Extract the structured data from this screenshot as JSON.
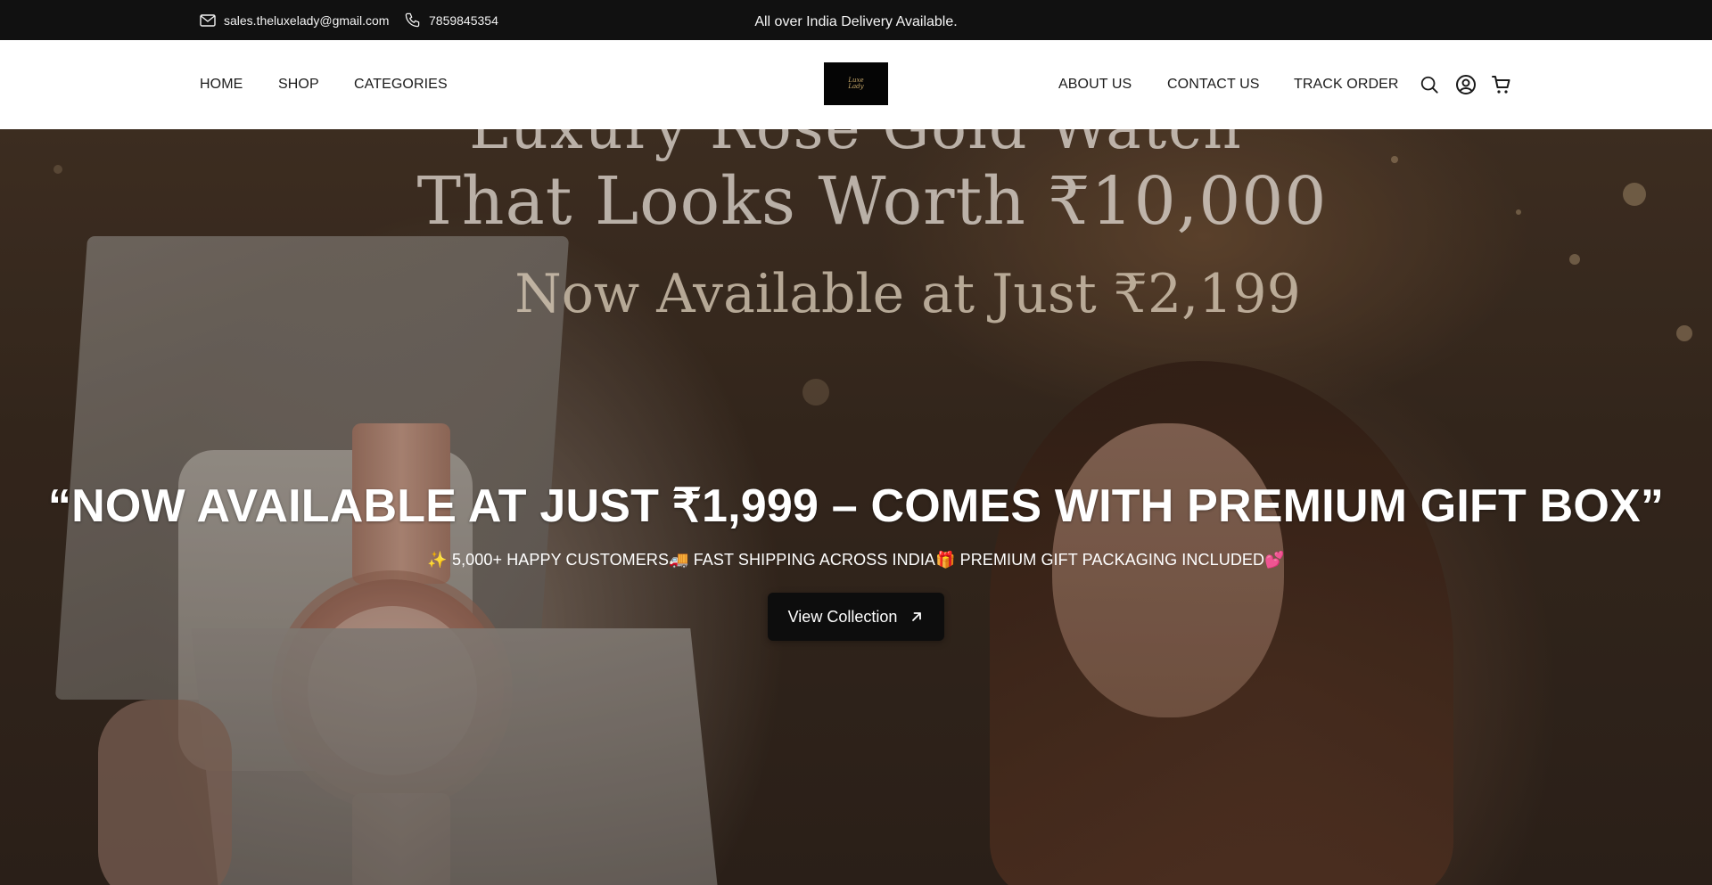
{
  "topbar": {
    "email": "sales.theluxelady@gmail.com",
    "phone": "7859845354",
    "announcement": "All over India Delivery Available."
  },
  "header": {
    "nav_left": [
      "HOME",
      "SHOP",
      "CATEGORIES"
    ],
    "nav_right": [
      "ABOUT US",
      "CONTACT US",
      "TRACK ORDER"
    ],
    "logo_text_line1": "Luxe",
    "logo_text_line2": "Lady"
  },
  "hero": {
    "image_text_line1": "Luxury Rose Gold Watch",
    "image_text_line2": "That Looks Worth ₹10,000",
    "image_text_line3": "Now Available at Just ₹2,199",
    "headline": "“NOW AVAILABLE AT JUST ₹1,999 – COMES WITH PREMIUM GIFT BOX”",
    "subline": "✨ 5,000+ HAPPY CUSTOMERS🚚 FAST SHIPPING ACROSS INDIA🎁 PREMIUM GIFT PACKAGING INCLUDED💕",
    "cta_label": "View Collection"
  },
  "icons": {
    "email": "mail-icon",
    "phone": "phone-icon",
    "search": "search-icon",
    "account": "user-circle-icon",
    "cart": "cart-icon",
    "cta_arrow": "arrow-up-right-icon"
  },
  "colors": {
    "topbar_bg": "#111111",
    "header_bg": "#ffffff",
    "cta_bg": "#0d0d0d",
    "logo_gold": "#c8a96a"
  }
}
